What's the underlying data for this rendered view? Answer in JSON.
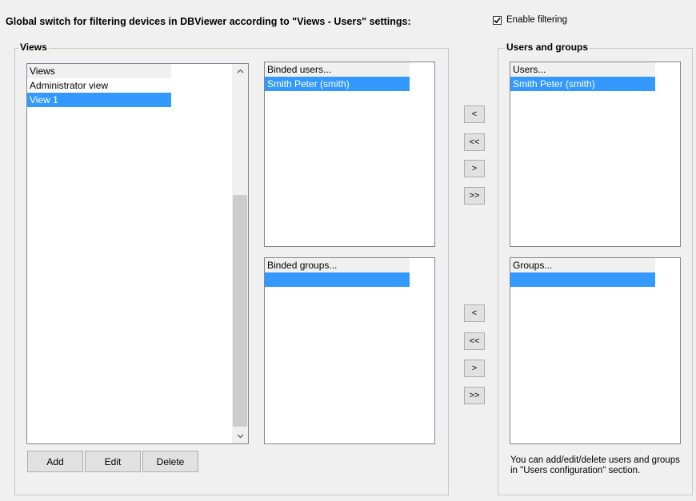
{
  "header": {
    "global_switch_text": "Global switch for filtering devices in DBViewer according to \"Views - Users\" settings:",
    "enable_filtering_label": "Enable filtering",
    "enable_filtering_checked": true
  },
  "views_group": {
    "title": "Views",
    "list_header": "Views",
    "items": [
      "Administrator view",
      "View 1"
    ],
    "selected_index": 1,
    "buttons": {
      "add": "Add",
      "edit": "Edit",
      "delete": "Delete"
    }
  },
  "binded_users": {
    "header": "Binded users...",
    "items": [
      "Smith Peter (smith)"
    ]
  },
  "binded_groups": {
    "header": "Binded groups...",
    "items": [
      ""
    ]
  },
  "transfer_buttons": {
    "left": "<",
    "all_left": "<<",
    "right": ">",
    "all_right": ">>"
  },
  "users_groups_group": {
    "title": "Users and groups",
    "users_header": "Users...",
    "users_items": [
      "Smith Peter (smith)"
    ],
    "groups_header": "Groups...",
    "groups_items": [
      ""
    ],
    "note": "You can add/edit/delete users and groups in \"Users configuration\" section."
  },
  "colors": {
    "selection": "#3399ff",
    "window_bg": "#f0f0f0"
  },
  "icons": {
    "checkbox": "checkmark-icon",
    "scroll_up": "scroll-up-arrow-icon",
    "scroll_down": "scroll-down-arrow-icon"
  }
}
